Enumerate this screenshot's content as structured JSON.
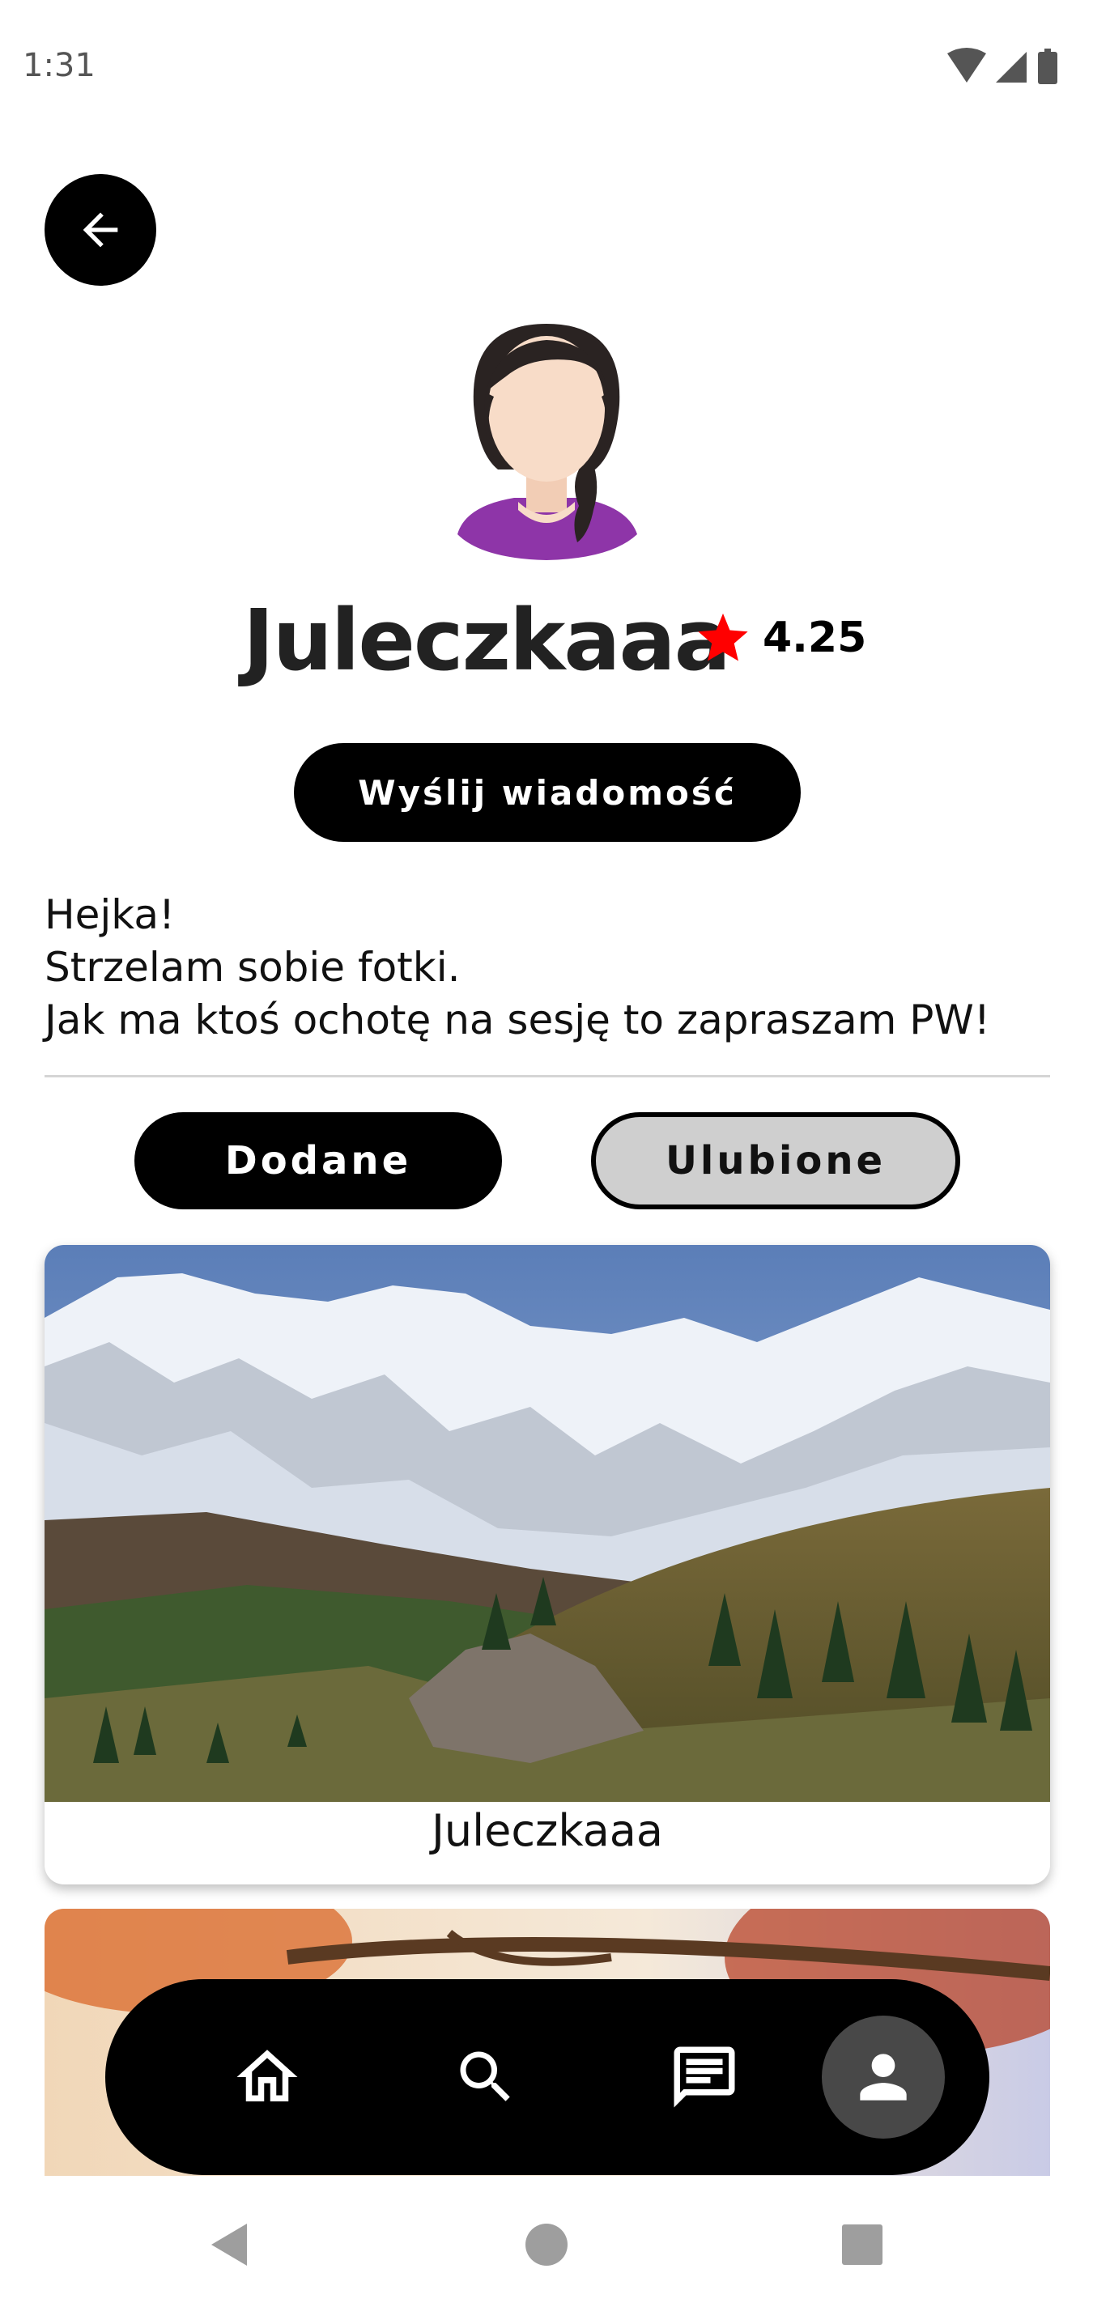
{
  "status_bar": {
    "time": "1:31",
    "icons": [
      "wifi-icon",
      "signal-icon",
      "battery-icon"
    ]
  },
  "profile": {
    "back_icon": "arrow-left-icon",
    "avatar_icon": "user-avatar",
    "name": "Juleczkaaa",
    "rating_icon": "star-icon",
    "rating": "4.25",
    "rating_color": "#ff0000",
    "send_message_label": "Wyślij wiadomość",
    "bio_lines": [
      "Hejka!",
      "Strzelam sobie fotki.",
      "Jak ma ktoś ochotę na sesję to zapraszam PW!"
    ]
  },
  "tabs": [
    {
      "label": "Dodane",
      "active": true
    },
    {
      "label": "Ulubione",
      "active": false
    }
  ],
  "posts": [
    {
      "image": "mountain-landscape-photo",
      "author": "Juleczkaaa"
    },
    {
      "image": "autumn-tree-photo"
    }
  ],
  "bottom_nav": {
    "items": [
      "home-icon",
      "search-icon",
      "chat-icon",
      "profile-icon"
    ],
    "active": "profile-icon"
  },
  "system_nav": [
    "back-triangle-icon",
    "home-circle-icon",
    "recents-square-icon"
  ]
}
